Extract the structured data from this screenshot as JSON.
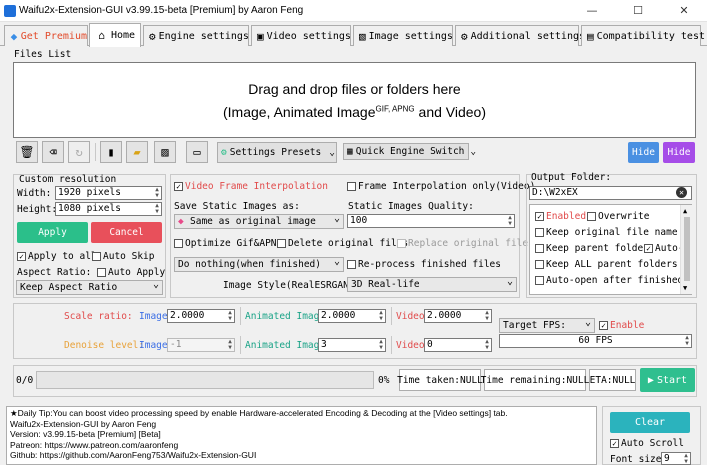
{
  "window": {
    "title": "Waifu2x-Extension-GUI v3.99.15-beta [Premium] by Aaron Feng",
    "minimize": "—",
    "maximize": "☐",
    "close": "✕"
  },
  "tabs": [
    {
      "label": "Get Premium",
      "icon": "gem-icon"
    },
    {
      "label": "Home",
      "icon": "home-icon"
    },
    {
      "label": "Engine settings",
      "icon": "gear-icon"
    },
    {
      "label": "Video settings",
      "icon": "film-icon"
    },
    {
      "label": "Image settings",
      "icon": "image-icon"
    },
    {
      "label": "Additional settings",
      "icon": "cog-icon"
    },
    {
      "label": "Compatibility test",
      "icon": "clipboard-icon"
    }
  ],
  "files": {
    "group_title": "Files List",
    "drop_line1": "Drag and drop files or folders here",
    "drop_line2_a": "(Image, Animated Image",
    "drop_line2_sup": "GIF, APNG",
    "drop_line2_b": " and Video)"
  },
  "toolbar": {
    "settings_presets": "Settings Presets",
    "quick_engine_switch": "Quick Engine Switch",
    "hide1": "Hide",
    "hide2": "Hide"
  },
  "resolution": {
    "title": "Custom resolution",
    "width_label": "Width:",
    "width_value": "1920 pixels",
    "height_label": "Height:",
    "height_value": "1080 pixels",
    "apply": "Apply",
    "cancel": "Cancel",
    "apply_to_all": "Apply to all",
    "auto_skip": "Auto Skip",
    "aspect_ratio_label": "Aspect Ratio:",
    "auto_apply": "Auto Apply",
    "aspect_ratio_value": "Keep Aspect Ratio"
  },
  "middle": {
    "video_frame_interp": "Video Frame Interpolation",
    "frame_interp_only": "Frame Interpolation only(Video)",
    "save_static_label": "Save Static Images as:",
    "static_quality_label": "Static Images Quality:",
    "save_static_value": "Same as original image",
    "static_quality_value": "100",
    "optimize_gif": "Optimize Gif&APNG",
    "delete_original": "Delete original files",
    "replace_original": "Replace original file",
    "when_finished": "Do nothing(when finished)",
    "reprocess": "Re-process finished files",
    "image_style_label": "Image Style(RealESRGAN):",
    "image_style_value": "3D Real-life"
  },
  "output": {
    "title": "Output Folder:",
    "path": "D:\\W2xEX",
    "options": [
      {
        "label": "Enabled",
        "checked": true,
        "red": true
      },
      {
        "label": "Overwrite",
        "checked": false
      },
      {
        "label": "Keep original file name",
        "checked": false
      },
      {
        "label": "Keep parent folder",
        "checked": false
      },
      {
        "label": "Auto-c",
        "checked": true
      },
      {
        "label": "Keep ALL parent folders",
        "checked": false
      },
      {
        "label": "Auto-open after finished",
        "checked": false
      }
    ]
  },
  "scale": {
    "scale_label": "Scale ratio:",
    "denoise_label": "Denoise level:",
    "image": "Image",
    "animated_image": "Animated Image",
    "video": "Video",
    "scale_image": "2.0000",
    "scale_anim": "2.0000",
    "scale_video": "2.0000",
    "denoise_image": "-1",
    "denoise_anim": "3",
    "denoise_video": "0",
    "target_fps_label": "Target FPS:",
    "enable": "Enable",
    "fps_value": "60 FPS"
  },
  "progress": {
    "count": "0/0",
    "percent": "0%",
    "value": 0,
    "time_taken": "Time taken:NULL",
    "time_remaining": "Time remaining:NULL",
    "eta": "ETA:NULL",
    "start": "Start"
  },
  "log": {
    "lines": [
      "★Daily Tip:You can boost video processing speed by enable Hardware-accelerated Encoding & Decoding at the [Video settings] tab.",
      "Waifu2x-Extension-GUI by Aaron Feng",
      "Version: v3.99.15-beta [Premium] [Beta]",
      "Patreon: https://www.patreon.com/aaronfeng",
      "Github: https://github.com/AaronFeng753/Waifu2x-Extension-GUI"
    ],
    "clear": "Clear",
    "auto_scroll": "Auto Scroll",
    "font_size_label": "Font size:",
    "font_size_value": "9"
  },
  "colors": {
    "green": "#2bbf8a",
    "red": "#e8505b",
    "blue": "#4a90e2",
    "purple": "#a64de8",
    "start_green": "#2fbf8f"
  }
}
